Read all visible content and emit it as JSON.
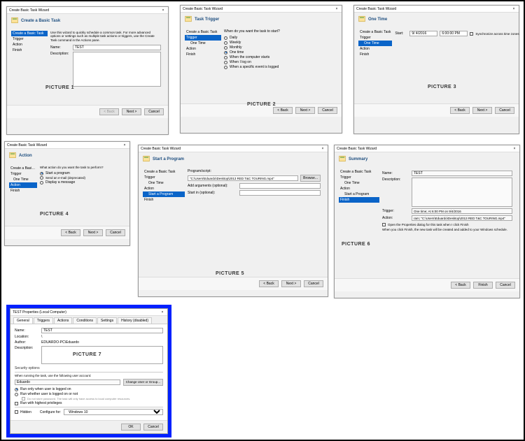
{
  "labels": {
    "p1": "PICTURE 1",
    "p2": "PICTURE 2",
    "p3": "PICTURE 3",
    "p4": "PICTURE 4",
    "p5": "PICTURE 5",
    "p6": "PICTURE 6",
    "p7": "PICTURE 7"
  },
  "common": {
    "wizard_title": "Create Basic Task Wizard",
    "close_x": "×",
    "back": "< Back",
    "next": "Next >",
    "cancel": "Cancel",
    "finish": "Finish",
    "browse": "Browse...",
    "ok": "OK"
  },
  "p1": {
    "header": "Create a Basic Task",
    "steps": {
      "s0": "Create a Basic Task",
      "s1": "Trigger",
      "s2": "Action",
      "s3": "Finish"
    },
    "intro": "Use this wizard to quickly schedule a common task. For more advanced options or settings such as multiple task actions or triggers, use the Create Task command in the Actions pane.",
    "name_lbl": "Name:",
    "name_val": "TEST",
    "desc_lbl": "Description:"
  },
  "p2": {
    "header": "Task Trigger",
    "steps": {
      "s0": "Create a Basic Task",
      "s1": "Trigger",
      "s1b": "One Time",
      "s2": "Action",
      "s3": "Finish"
    },
    "prompt": "When do you want the task to start?",
    "opts": {
      "daily": "Daily",
      "weekly": "Weekly",
      "monthly": "Monthly",
      "onetime": "One time",
      "startup": "When the computer starts",
      "logon": "When I log on",
      "event": "When a specific event is logged"
    }
  },
  "p3": {
    "header": "One Time",
    "steps": {
      "s0": "Create a Basic Task",
      "s1": "Trigger",
      "s1b": "One Time",
      "s2": "Action",
      "s3": "Finish"
    },
    "start_lbl": "Start:",
    "date": "9/ 4/2016",
    "time": "6:00:00 PM",
    "sync": "Synchronize across time zones"
  },
  "p4": {
    "header": "Action",
    "steps": {
      "s0": "Create a Basic Task",
      "s1": "Trigger",
      "s1b": "One Time",
      "s2": "Action",
      "s3": "Finish"
    },
    "prompt": "What action do you want the task to perform?",
    "opts": {
      "prog": "Start a program",
      "email": "Send an e-mail (deprecated)",
      "msg": "Display a message"
    }
  },
  "p5": {
    "header": "Start a Program",
    "steps": {
      "s0": "Create a Basic Task",
      "s1": "Trigger",
      "s1b": "One Time",
      "s2": "Action",
      "s2b": "Start a Program",
      "s3": "Finish"
    },
    "prog_lbl": "Program/script:",
    "prog_val": "\"C:\\Users\\Eduardo\\Desktop\\2013 RED T&C TOURING.mp4\"",
    "args_lbl": "Add arguments (optional):",
    "start_lbl": "Start in (optional):"
  },
  "p6": {
    "header": "Summary",
    "steps": {
      "s0": "Create a Basic Task",
      "s1": "Trigger",
      "s1b": "One Time",
      "s2": "Action",
      "s2b": "Start a Program",
      "s3": "Finish"
    },
    "name_lbl": "Name:",
    "name_val": "TEST",
    "desc_lbl": "Description:",
    "trigger_lbl": "Trigger:",
    "trigger_val": "One time; At 6:00 PM on 9/4/2016",
    "action_lbl": "Action:",
    "action_val": "ram; \"C:\\Users\\Eduardo\\Desktop\\2013 RED T&C TOURING.mp4\"",
    "open_dlg": "Open the Properties dialog for this task when I click Finish",
    "note": "When you click Finish, the new task will be created and added to your Windows schedule."
  },
  "p7": {
    "title": "TEST Properties (Local Computer)",
    "tabs": {
      "general": "General",
      "triggers": "Triggers",
      "actions": "Actions",
      "conditions": "Conditions",
      "settings": "Settings",
      "history": "History (disabled)"
    },
    "name_lbl": "Name:",
    "name_val": "TEST",
    "loc_lbl": "Location:",
    "loc_val": "\\",
    "author_lbl": "Author:",
    "author_val": "EDUARDO-PC\\Eduardo",
    "desc_lbl": "Description:",
    "sec_hdr": "Security options",
    "sec_line": "When running the task, use the following user account:",
    "user": "Eduardo",
    "change": "Change User or Group...",
    "r1": "Run only when user is logged on",
    "r2": "Run whether user is logged on or not",
    "r2b": "Do not store password. The task will only have access to local computer resources.",
    "r3": "Run with highest privileges",
    "hidden": "Hidden",
    "config_lbl": "Configure for:",
    "config_val": "Windows 10"
  }
}
